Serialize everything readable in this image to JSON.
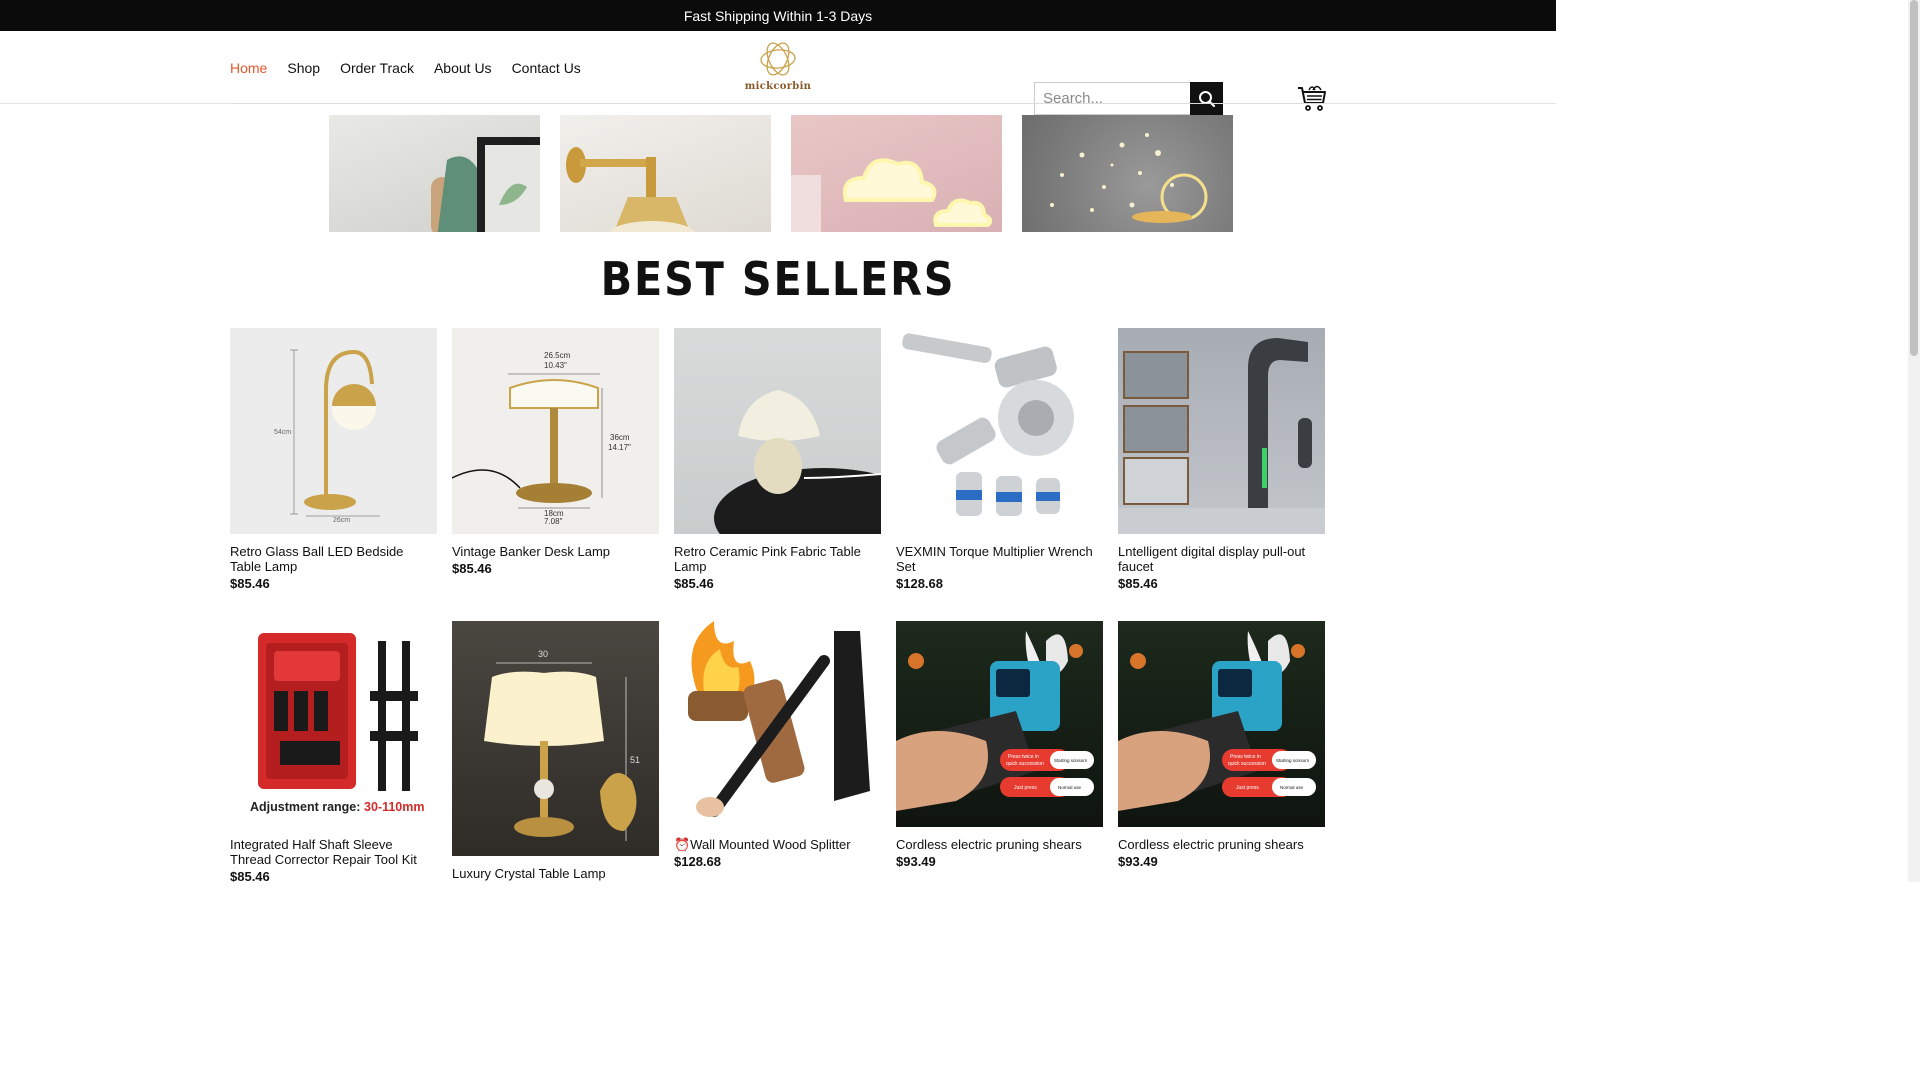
{
  "announcement": "Fast Shipping Within 1-3 Days",
  "nav": {
    "items": [
      "Home",
      "Shop",
      "Order Track",
      "About Us",
      "Contact Us"
    ]
  },
  "logo": {
    "text": "mickcorbin"
  },
  "search": {
    "placeholder": "Search..."
  },
  "section": {
    "title": "BEST SELLERS"
  },
  "products": [
    {
      "name": "Retro Glass Ball LED Bedside Table Lamp",
      "price": "$85.46",
      "dim_h": "54cm",
      "dim_w": "26cm"
    },
    {
      "name": "Vintage Banker Desk Lamp",
      "price": "$85.46",
      "dim_top": "26.5cm",
      "dim_top2": "10.43\"",
      "dim_side": "36cm",
      "dim_side2": "14.17\"",
      "dim_base": "18cm",
      "dim_base2": "7.08\""
    },
    {
      "name": "Retro Ceramic Pink Fabric Table Lamp",
      "price": "$85.46"
    },
    {
      "name": "VEXMIN Torque Multiplier Wrench Set",
      "price": "$128.68"
    },
    {
      "name": "Lntelligent digital display pull-out faucet",
      "price": "$85.46"
    },
    {
      "name": "Integrated Half Shaft Sleeve Thread Corrector Repair Tool Kit",
      "price": "$85.46",
      "caption_prefix": "Adjustment range: ",
      "caption_range": "30-110mm"
    },
    {
      "name": "Luxury Crystal Table Lamp",
      "price": "",
      "dim_w": "30",
      "dim_h": "51"
    },
    {
      "name": "⏰Wall Mounted Wood Splitter",
      "price": "$128.68"
    },
    {
      "name": "Cordless electric pruning shears",
      "price": "$93.49",
      "tag1a": "Press twice in",
      "tag1b": "quick succession",
      "tag1c": "Starting scissors",
      "tag2a": "Just press",
      "tag2b": "Normal use"
    },
    {
      "name": "Cordless electric pruning shears",
      "price": "$93.49",
      "tag1a": "Press twice in",
      "tag1b": "quick succession",
      "tag1c": "Starting scissors",
      "tag2a": "Just press",
      "tag2b": "Normal use"
    }
  ],
  "icons": [
    "search-icon",
    "cart-icon",
    "logo-icon"
  ],
  "colors": {
    "accent": "#e4572e",
    "topbar": "#0b0b0b",
    "logo": "#c9a24a"
  }
}
